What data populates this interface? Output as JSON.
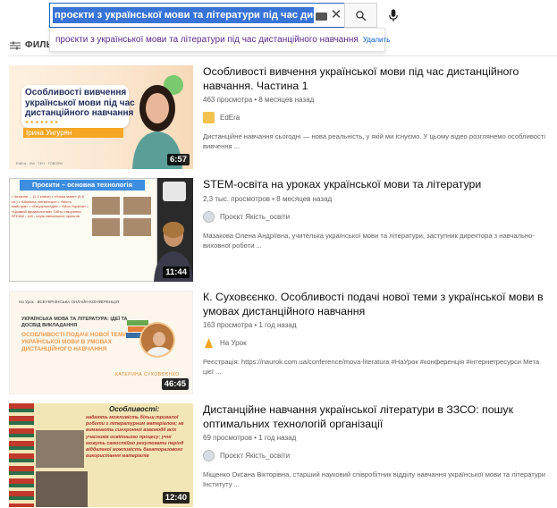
{
  "search": {
    "query": "проєкти з української мови та літератури під час дистанційного на"
  },
  "suggestion": {
    "text": "проєкти з української мови та літератури під час дистанційного навчання",
    "remove_label": "Удалить"
  },
  "filter": {
    "label": "ФИЛЬТ"
  },
  "results": [
    {
      "title": "Особливості вивчення української мови під час дистанційного навчання. Частина 1",
      "meta": "463 просмотра • 8 месяцев назад",
      "channel": "EdEra",
      "description": "Дистанційне навчання сьогодні — нова реальність, у якій ми існуємо. У цьому відео розглянемо особливості вивчення ...",
      "duration": "6:57",
      "thumb": {
        "card_text": "Особливості вивчення української мови під час дистанційного навчання",
        "presenter": "Ірина Унгурян",
        "logos": "EdEra  · ЛМ  · ТЕН  · ГОВОРИ"
      }
    },
    {
      "title": "STEM-освіта на уроках української мови та літератури",
      "meta": "2,3 тыс. просмотров • 8 месяцев назад",
      "channel": "Проєкт Якість_освіти",
      "description": "Мазакова Олена Андріївна, учителька української мови та літератури, заступник директора з навчально-виховної роботи ...",
      "duration": "11:44",
      "thumb": {
        "slide_title": "Проєкти – основна технологія STEAM",
        "slide_lines": "• Читання ... (1-2 класи) • «Наша мова» (5-6 кл.) • «Шкільна лінгвістика» • «Місто майстрів» • «Енциклопедія» • «Моя Україна» • «Цікавий фразеологізм» Тобто створення STEAM - 1x8 - серія навчальних проєктів"
      }
    },
    {
      "title": "К. Суховєєнко. Особливості подачі нової теми з української мови в умовах дистанційного навчання",
      "meta": "163 просмотра • 1 год назад",
      "channel": "На Урок",
      "description": "Реєстрація: https://naurok.com.ua/conference/mova-literatura #НаУрок #конференція #інтернетресурси Мета цієї ...",
      "duration": "46:45",
      "thumb": {
        "brand": "На Урок  ·  ВСЕУКРАЇНСЬКА ОНЛАЙН-КОНФЕРЕНЦІЯ",
        "subtitle": "УКРАЇНСЬКА МОВА ТА ЛІТЕРАТУРА: ІДЕЇ ТА ДОСВІД ВИКЛАДАННЯ",
        "main": "ОСОБЛИВОСТІ ПОДАЧІ НОВОЇ ТЕМИ З УКРАЇНСЬКОЇ МОВИ В УМОВАХ ДИСТАНЦІЙНОГО НАВЧАННЯ",
        "author": "КАТЕРИНА СУХОВЄЄНКО"
      }
    },
    {
      "title": "Дистанційне навчання української літератури в ЗЗСО: пошук оптимальних технологій організації",
      "meta": "69 просмотров • 1 год назад",
      "channel": "Проєкт Якість_освіти",
      "description": "Міщенко Оксана Вікторівна, старший науковий співробітник відділу навчання української мови та літератури Інституту ...",
      "duration": "12:40",
      "thumb": {
        "heading": "Особливості:",
        "text": "надають можливість більш тривалої роботи з літературним матеріалом; не вимагають синхронної взаємодії всіх учасників освітнього процесу; учні можуть самостійно регулювати період віддаленої можливість багаторазового використання матеріалів"
      }
    }
  ],
  "colors": {
    "query_highlight": "#3874d8",
    "link_blue": "#065fd4",
    "visited_purple": "#5b2a8c",
    "meta_gray": "#606060",
    "accent_orange": "#f5a623"
  }
}
